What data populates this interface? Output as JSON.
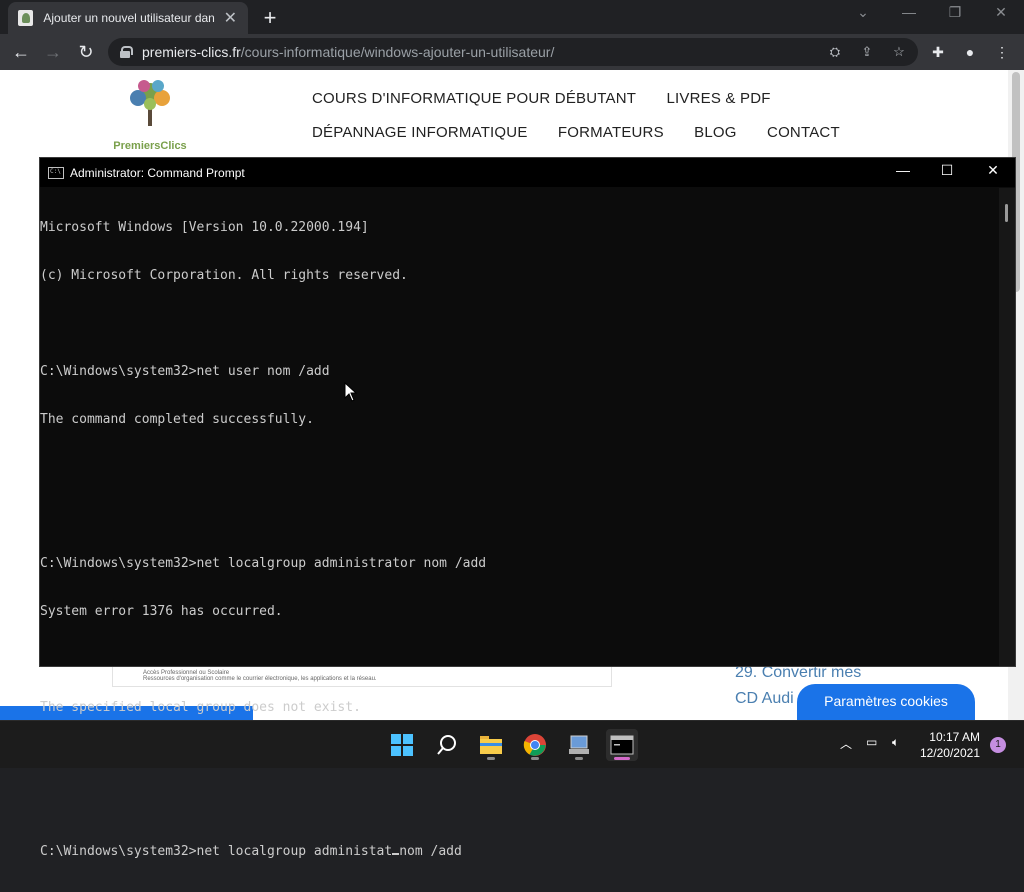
{
  "browser": {
    "tab_title": "Ajouter un nouvel utilisateur dan",
    "tab_close": "✕",
    "new_tab": "+",
    "url_host": "premiers-clics.fr",
    "url_path": "/cours-informatique/windows-ajouter-un-utilisateur/"
  },
  "site": {
    "brand": "PremiersClics",
    "nav_row1": [
      "COURS D'INFORMATIQUE POUR DÉBUTANT",
      "LIVRES & PDF"
    ],
    "nav_row2": [
      "DÉPANNAGE INFORMATIQUE",
      "FORMATEURS",
      "BLOG",
      "CONTACT"
    ],
    "sub_title": "Accès Professionnel ou Scolaire",
    "sub_text": "Ressources d'organisation comme le courrier électronique, les applications et la réseau.",
    "side_link1": "29. Convertir mes",
    "side_link2": "CD Audi",
    "cookies_button": "Paramètres cookies"
  },
  "cmd": {
    "title": "Administrator: Command Prompt",
    "lines": [
      "Microsoft Windows [Version 10.0.22000.194]",
      "(c) Microsoft Corporation. All rights reserved.",
      "",
      "C:\\Windows\\system32>net user nom /add",
      "The command completed successfully.",
      "",
      "",
      "C:\\Windows\\system32>net localgroup administrator nom /add",
      "System error 1376 has occurred.",
      "",
      "The specified local group does not exist.",
      "",
      ""
    ],
    "prompt_line_before_cursor": "C:\\Windows\\system32>net localgroup administat",
    "prompt_line_after_cursor": "nom /add"
  },
  "taskbar": {
    "time": "10:17 AM",
    "date": "12/20/2021",
    "notification_count": "1"
  },
  "colors": {
    "console_bg": "#0c0c0c",
    "console_text": "#cccccc",
    "chrome_accent": "#1a73e8"
  }
}
